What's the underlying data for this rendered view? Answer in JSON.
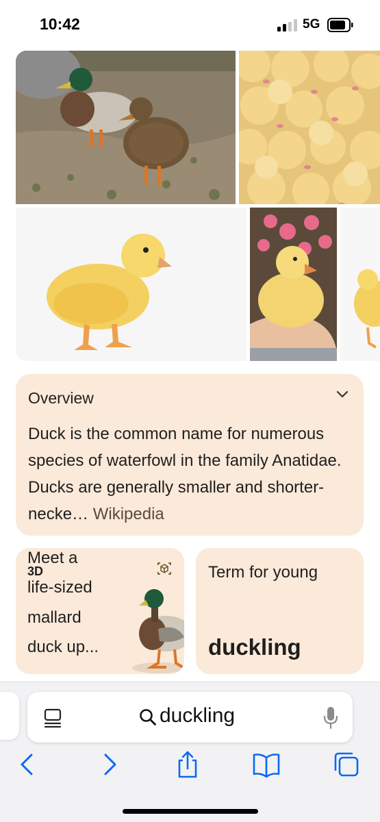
{
  "status_bar": {
    "time": "10:42",
    "network": "5G",
    "signal_bars_active": 2,
    "signal_bars_total": 4
  },
  "images": [
    {
      "name": "mallard-pair",
      "description_icon": "photo"
    },
    {
      "name": "ducklings-crowd",
      "description_icon": "photo"
    },
    {
      "name": "yellow-duckling",
      "description_icon": "photo"
    },
    {
      "name": "duckling-in-hand",
      "description_icon": "photo"
    },
    {
      "name": "duckling-partial",
      "description_icon": "photo"
    }
  ],
  "overview": {
    "title": "Overview",
    "snippet": "Duck is the common name for numerous species of waterfowl in the family Anatidae. Ducks are generally smaller and shorter-necke…",
    "source": "Wikipedia"
  },
  "card_3d": {
    "line1": "Meet a",
    "line2": "3D",
    "line3": "life-sized",
    "line4": "mallard",
    "line5": "duck up..."
  },
  "card_young": {
    "title": "Term for young",
    "answer": "duckling"
  },
  "address_bar": {
    "query": "duckling"
  },
  "colors": {
    "card_bg": "#fbe9d9",
    "accent_blue": "#0a68f2",
    "toolbar_bg": "#f2f2f4"
  },
  "icons": {
    "back": "chevron-left-icon",
    "forward": "chevron-right-icon",
    "share": "share-icon",
    "bookmarks": "book-icon",
    "tabs": "tabs-icon"
  }
}
